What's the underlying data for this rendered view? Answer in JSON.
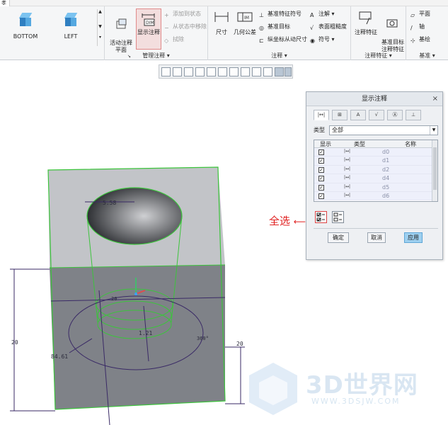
{
  "top_tab": "孝",
  "ribbon": {
    "views": {
      "bottom": "BOTTOM",
      "left": "LEFT"
    },
    "active_annot_plane": "活动注释\n平面",
    "show_annot": "显示注释",
    "add_to_state": "添加到状态",
    "remove_from_state": "从状态中移除",
    "erase": "拭除",
    "manage_group": "管理注释",
    "dimension": "尺寸",
    "geom_tol": "几何公差",
    "datum_feature": "基准特征符号",
    "datum_target": "基准目标",
    "ordinate_dim": "纵坐标从动尺寸",
    "note": "注解",
    "surface_finish": "表面粗糙度",
    "symbol": "符号",
    "annot_group": "注释",
    "annot_feature": "注释特征",
    "datum_target_annot": "基准目标\n注释特征",
    "annot_feature_group": "注释特征",
    "plane": "平面",
    "axis": "轴",
    "coord": "基绘",
    "datum_group": "基准"
  },
  "dialog": {
    "title": "显示注释",
    "close": "×",
    "tab_icons": [
      "|↔|",
      "⊞",
      "A",
      "√",
      "Ⓐ",
      "⊥"
    ],
    "type_label": "类型",
    "type_value": "全部",
    "col_show": "显示",
    "col_type": "类型",
    "col_name": "名称",
    "rows": [
      {
        "checked": "✓",
        "type": "|↔|",
        "name": "d0"
      },
      {
        "checked": "✓",
        "type": "|↔|",
        "name": "d1"
      },
      {
        "checked": "✓",
        "type": "|↔|",
        "name": "d2"
      },
      {
        "checked": "✓",
        "type": "|↔|",
        "name": "d4"
      },
      {
        "checked": "✓",
        "type": "|↔|",
        "name": "d5"
      },
      {
        "checked": "✓",
        "type": "|↔|",
        "name": "d6"
      }
    ],
    "ok": "确定",
    "cancel": "取消",
    "apply": "应用"
  },
  "annotation_label": "全选",
  "dims": {
    "d_top": "5.58",
    "d_inner": "20",
    "d_depth": "1.21",
    "d_angle": "360°",
    "d_dia": "84.61",
    "d_left_height": "20",
    "d_right_height": "20"
  },
  "watermark": {
    "title": "3D世界网",
    "sub": "WWW.3DSJW.COM"
  },
  "colors": {
    "accent": "#5fa6d6",
    "model_edge": "#3cc43c",
    "annotation_red": "#e02020"
  }
}
